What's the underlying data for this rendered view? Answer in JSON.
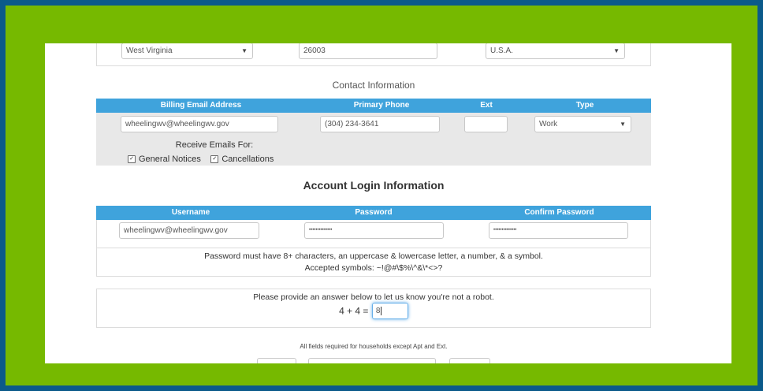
{
  "address": {
    "state": "West Virginia",
    "zip": "26003",
    "country": "U.S.A."
  },
  "contact": {
    "section_title": "Contact Information",
    "headers": {
      "email": "Billing Email Address",
      "phone": "Primary Phone",
      "ext": "Ext",
      "type": "Type"
    },
    "email_value": "wheelingwv@wheelingwv.gov",
    "phone_value": "(304) 234-3641",
    "ext_value": "",
    "type_value": "Work",
    "receive_label": "Receive Emails For:",
    "options": [
      {
        "label": "General Notices",
        "checked": true
      },
      {
        "label": "Cancellations",
        "checked": true
      }
    ]
  },
  "login": {
    "section_title": "Account Login Information",
    "headers": {
      "username": "Username",
      "password": "Password",
      "confirm": "Confirm Password"
    },
    "username_value": "wheelingwv@wheelingwv.gov",
    "password_mask": "••••••••••••••",
    "confirm_mask": "••••••••••••••",
    "rule_line1": "Password must have 8+ characters, an uppercase & lowercase letter, a number, & a symbol.",
    "rule_line2": "Accepted symbols: ~!@#\\$%\\^&\\*<>?"
  },
  "captcha": {
    "prompt": "Please provide an answer below to let us know you're not a robot.",
    "question": "4 + 4 =",
    "answer": "8"
  },
  "footer_note": "All fields required for households except Apt and Ext.",
  "colors": {
    "outer_border": "#0b5a8a",
    "green_frame": "#76b900",
    "header_blue": "#3fa3dc",
    "grey_row": "#e8e8e8"
  }
}
